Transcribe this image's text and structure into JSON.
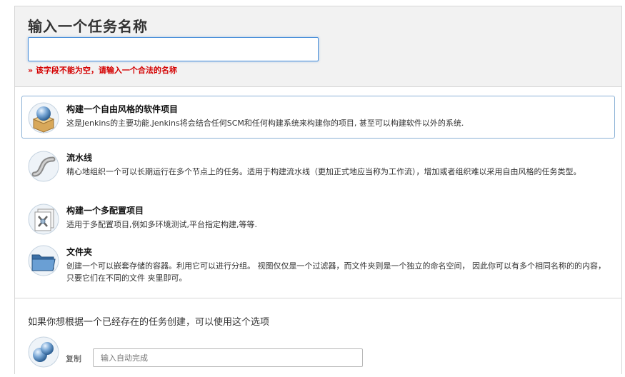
{
  "name_section": {
    "title": "输入一个任务名称",
    "input_value": "",
    "error": "» 该字段不能为空，请输入一个合法的名称"
  },
  "job_types": [
    {
      "label": "构建一个自由风格的软件项目",
      "description": "这是Jenkins的主要功能.Jenkins将会结合任何SCM和任何构建系统来构建你的项目, 甚至可以构建软件以外的系统.",
      "icon": "freestyle-project-icon",
      "selected": true
    },
    {
      "label": "流水线",
      "description": "精心地组织一个可以长期运行在多个节点上的任务。适用于构建流水线（更加正式地应当称为工作流），增加或者组织难以采用自由风格的任务类型。",
      "icon": "pipeline-icon",
      "selected": false
    },
    {
      "label": "构建一个多配置项目",
      "description": "适用于多配置项目,例如多环境测试,平台指定构建,等等.",
      "icon": "multi-config-project-icon",
      "selected": false
    },
    {
      "label": "文件夹",
      "description": "创建一个可以嵌套存储的容器。利用它可以进行分组。 视图仅仅是一个过滤器，而文件夹则是一个独立的命名空间， 因此你可以有多个相同名称的的内容，只要它们在不同的文件 夹里即可。",
      "icon": "folder-icon",
      "selected": false
    }
  ],
  "copy_section": {
    "hint": "如果你想根据一个已经存在的任务创建，可以使用这个选项",
    "label": "复制",
    "placeholder": "输入自动完成",
    "icon": "copy-job-icon"
  },
  "colors": {
    "error": "#d40000",
    "focus_border": "#4a90d9",
    "selected_border": "#8bb1d6",
    "header_bg": "#f2f2f2"
  }
}
